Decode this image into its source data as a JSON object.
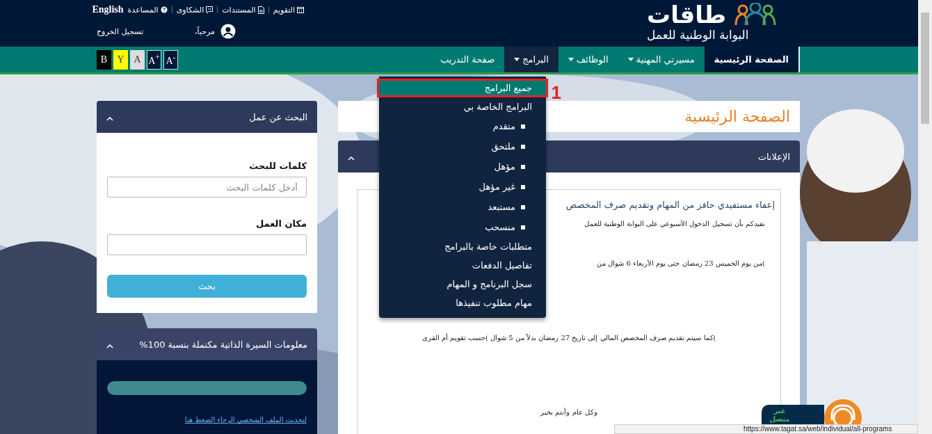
{
  "header": {
    "logo": {
      "name": "طاقات",
      "tagline": "البوابة الوطنية للعمل"
    },
    "top_links": [
      {
        "kind": "calendar",
        "label": "التقويم"
      },
      {
        "kind": "document",
        "label": "المستندات"
      },
      {
        "kind": "chat",
        "label": "الشكاوى"
      },
      {
        "kind": "help",
        "label": "المساعدة"
      },
      {
        "kind": "language",
        "label": "English"
      }
    ],
    "user": {
      "greeting": "مرحباً،",
      "logout": "تسجيل الخروج"
    }
  },
  "nav": {
    "items": [
      {
        "label": "الصفحة الرئيسية",
        "dropdown": false,
        "selected": true,
        "open": false
      },
      {
        "label": "مسيرتي المهنية",
        "dropdown": true,
        "selected": false,
        "open": false
      },
      {
        "label": "الوظائف",
        "dropdown": true,
        "selected": false,
        "open": false
      },
      {
        "label": "البرامج",
        "dropdown": true,
        "selected": false,
        "open": true
      },
      {
        "label": "صفحة التدريب",
        "dropdown": false,
        "selected": false,
        "open": false
      }
    ],
    "accessibility_buttons": [
      {
        "label": "$^{-}$A",
        "kind": "navy"
      },
      {
        "label": "$^{+}$A",
        "kind": "navy"
      },
      {
        "label": "A",
        "kind": "grey"
      },
      {
        "label": "Y",
        "kind": "yellow"
      },
      {
        "label": "B",
        "kind": "black"
      }
    ]
  },
  "dropdown": {
    "annotation": "1",
    "items": [
      {
        "label": "جميع البرامج",
        "kind": "item",
        "selected": true
      },
      {
        "label": "البرامج الخاصة بي",
        "kind": "item",
        "selected": false
      },
      {
        "label": "متقدم",
        "kind": "subitem",
        "selected": false
      },
      {
        "label": "ملتحق",
        "kind": "subitem",
        "selected": false
      },
      {
        "label": "مؤهل",
        "kind": "subitem",
        "selected": false
      },
      {
        "label": "غير مؤهل",
        "kind": "subitem",
        "selected": false
      },
      {
        "label": "مستبعد",
        "kind": "subitem",
        "selected": false
      },
      {
        "label": "منسحب",
        "kind": "subitem",
        "selected": false
      },
      {
        "label": "متطلبات خاصة بالبرامج",
        "kind": "item",
        "selected": false
      },
      {
        "label": "تفاصيل الدفعات",
        "kind": "item",
        "selected": false
      },
      {
        "label": "سجل البرنامج و المهام",
        "kind": "item",
        "selected": false
      },
      {
        "label": "مهام مطلوب تنفيذها",
        "kind": "item",
        "selected": false
      }
    ]
  },
  "main": {
    "title": "الصفحة الرئيسية",
    "announcements": {
      "title": "الإعلانات",
      "expanded": true,
      "headline": "إعفاء مستفيدي حافز من المهام وتقديم صرف المخصص",
      "paragraphs": [
        {
          "kind": "right",
          "text": "نفيدكم بأن تسجيل الدخول الأسبوعي على البوابة الوطنية للعمل"
        },
        {
          "kind": "right",
          "text": ")من يوم الخميس 23 رمضان حتى يوم الأربعاء 6 شوال من"
        },
        {
          "kind": "center",
          "text": ")كما سيتم تقديم صرف المخصص المالي إلى تاريخ 27 رمضان بدلاً من 5 شوال )حسب تقويم أم القرى"
        },
        {
          "kind": "center",
          "text": "وكل عام وأنتم بخير"
        }
      ]
    }
  },
  "sidebar": {
    "search": {
      "title": "البحث عن عمل",
      "expanded": true,
      "fields": [
        {
          "label": "كلمات للبحث",
          "placeholder": "أدخل كلمات البحث"
        },
        {
          "label": "مكان العمل"
        }
      ],
      "button": "بحث"
    },
    "cv": {
      "title": "معلومات السيرة الذاتية مكتملة بنسبة 100%",
      "expanded": true,
      "level": 1,
      "link": "لتحديث الملف الشخصي الرجاء الضغط هنا"
    }
  },
  "chat": {
    "status": "غير متصل"
  },
  "status_bar": {
    "url": "https://www.tagat.sa/web/individual/all-programs"
  }
}
